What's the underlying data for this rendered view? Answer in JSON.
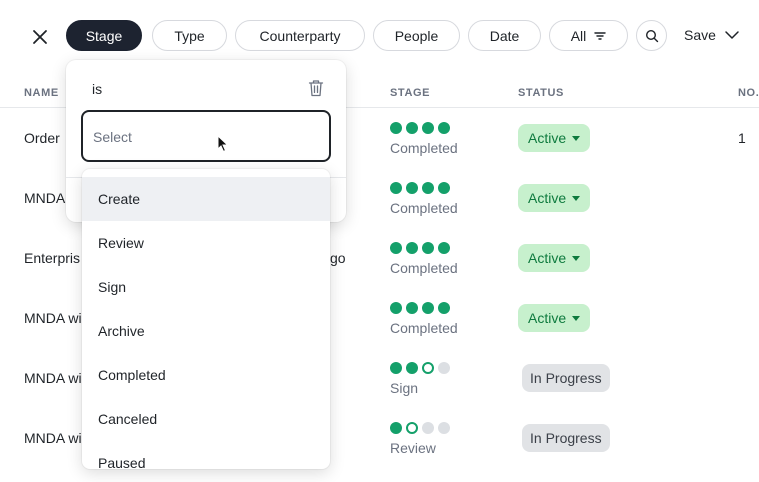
{
  "toolbar": {
    "filters": [
      "Stage",
      "Type",
      "Counterparty",
      "People",
      "Date"
    ],
    "all_label": "All",
    "save_label": "Save",
    "icons": [
      "close-icon",
      "filter-icon",
      "search-icon",
      "chevron-down-icon"
    ]
  },
  "table": {
    "headers": {
      "name": "NAME",
      "stage": "STAGE",
      "status": "STATUS",
      "no": "NO."
    },
    "rows": [
      {
        "name": "Order",
        "name_tail": "",
        "stage_dots": [
          "done",
          "done",
          "done",
          "done"
        ],
        "stage": "Completed",
        "status": "Active",
        "status_type": "active",
        "no": "1"
      },
      {
        "name": "MNDA",
        "name_tail": "",
        "stage_dots": [
          "done",
          "done",
          "done",
          "done"
        ],
        "stage": "Completed",
        "status": "Active",
        "status_type": "active",
        "no": ""
      },
      {
        "name": "Enterpris",
        "name_tail": "go",
        "stage_dots": [
          "done",
          "done",
          "done",
          "done"
        ],
        "stage": "Completed",
        "status": "Active",
        "status_type": "active",
        "no": ""
      },
      {
        "name": "MNDA wi",
        "name_tail": "",
        "stage_dots": [
          "done",
          "done",
          "done",
          "done"
        ],
        "stage": "Completed",
        "status": "Active",
        "status_type": "active",
        "no": ""
      },
      {
        "name": "MNDA wi",
        "name_tail": "",
        "stage_dots": [
          "done",
          "done",
          "current",
          "todo"
        ],
        "stage": "Sign",
        "status": "In Progress",
        "status_type": "progress",
        "no": ""
      },
      {
        "name": "MNDA wi",
        "name_tail": "",
        "stage_dots": [
          "done",
          "current",
          "todo",
          "todo"
        ],
        "stage": "Review",
        "status": "In Progress",
        "status_type": "progress",
        "no": ""
      }
    ]
  },
  "popover": {
    "operator": "is",
    "select_placeholder": "Select",
    "icons": [
      "trash-icon"
    ]
  },
  "dropdown": {
    "options": [
      "Create",
      "Review",
      "Sign",
      "Archive",
      "Completed",
      "Canceled",
      "Paused"
    ],
    "highlighted": "Create"
  },
  "colors": {
    "accent_dark": "#1d2330",
    "stage_done": "#14a06a",
    "active_badge_bg": "#c7f0cd",
    "active_badge_text": "#0e7a3e",
    "progress_badge_bg": "#e1e3e6"
  }
}
